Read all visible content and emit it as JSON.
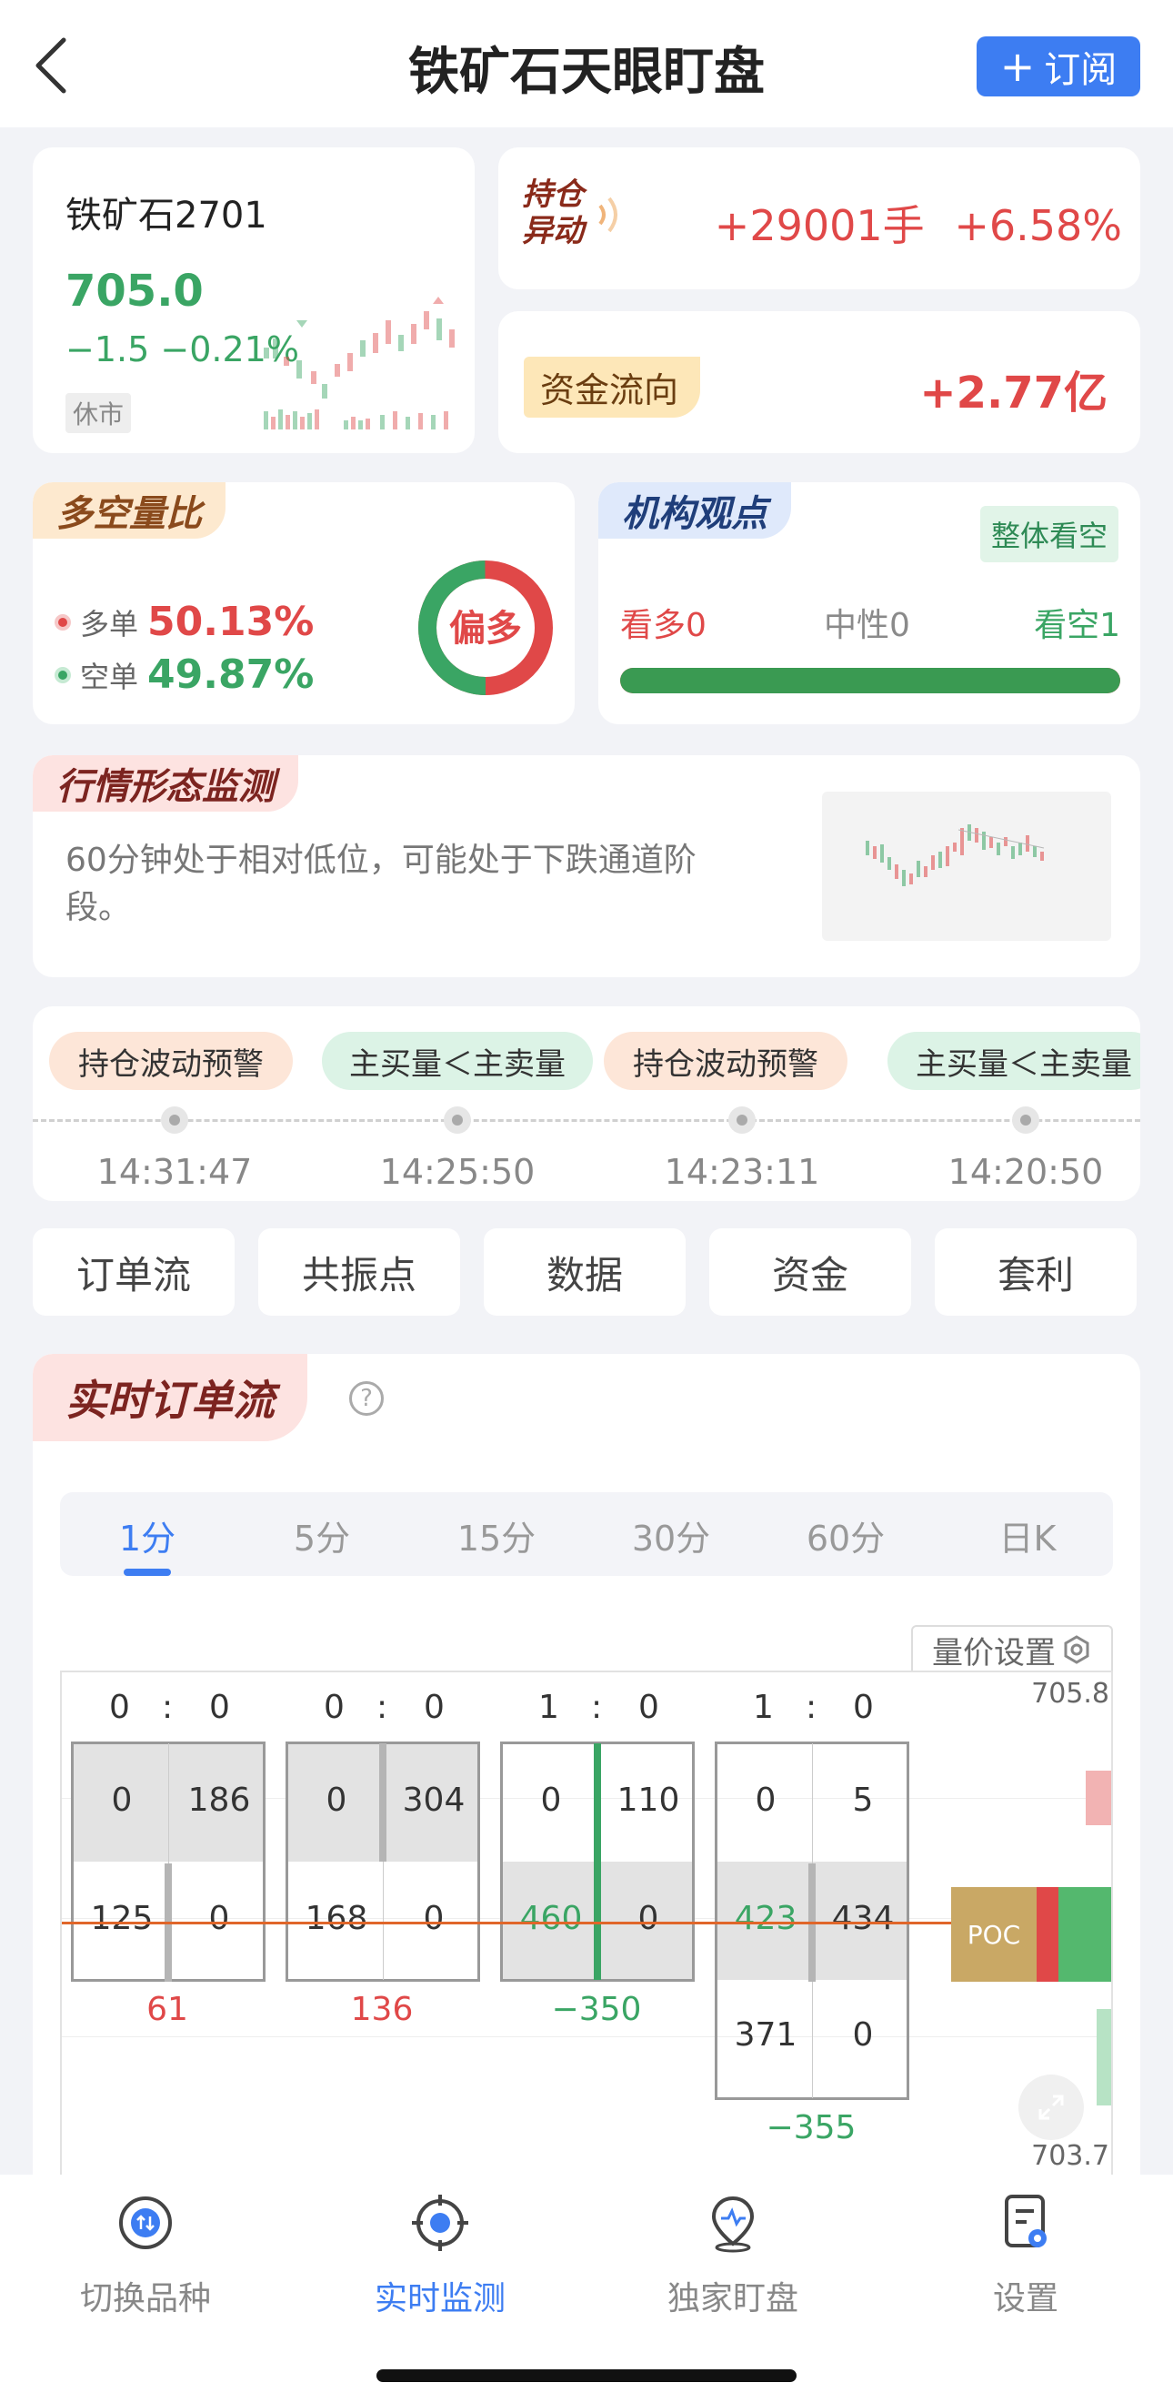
{
  "header": {
    "title": "铁矿石天眼盯盘",
    "subscribe_label": "订阅"
  },
  "quote": {
    "contract": "铁矿石2701",
    "price": "705.0",
    "change": "−1.5",
    "change_pct": "−0.21%",
    "status": "休市"
  },
  "position": {
    "tag": "持仓异动",
    "tag_line1": "持仓",
    "tag_line2": "异动",
    "lots": "+29001手",
    "pct": "+6.58%"
  },
  "fund_flow": {
    "tag": "资金流向",
    "value": "+2.77亿"
  },
  "long_short": {
    "tag": "多空量比",
    "long_label": "多单",
    "long_pct": "50.13%",
    "short_label": "空单",
    "short_pct": "49.87%",
    "bias": "偏多",
    "long_ratio": 0.5013
  },
  "institution": {
    "tag": "机构观点",
    "badge": "整体看空",
    "bull": "看多0",
    "neutral": "中性0",
    "bear": "看空1",
    "bear_ratio": 1.0
  },
  "pattern": {
    "tag": "行情形态监测",
    "text": "60分钟处于相对低位，可能处于下跌通道阶段。"
  },
  "timeline": [
    {
      "label": "持仓波动预警",
      "time": "14:31:47",
      "kind": "orange"
    },
    {
      "label": "主买量＜主卖量",
      "time": "14:25:50",
      "kind": "green"
    },
    {
      "label": "持仓波动预警",
      "time": "14:23:11",
      "kind": "orange"
    },
    {
      "label": "主买量＜主卖量",
      "time": "14:20:50",
      "kind": "green"
    }
  ],
  "sections": [
    "订单流",
    "共振点",
    "数据",
    "资金",
    "套利"
  ],
  "orderflow": {
    "title": "实时订单流",
    "help": "?",
    "periods": [
      "1分",
      "5分",
      "15分",
      "30分",
      "60分",
      "日K"
    ],
    "active_period": "1分",
    "settings_label": "量价设置",
    "price_high": "705.8",
    "price_low": "703.7",
    "poc_label": "POC",
    "bars": [
      {
        "score_left": "0",
        "score_right": "0",
        "rows": [
          [
            "0",
            "186"
          ],
          [
            "125",
            "0"
          ]
        ],
        "net": "61"
      },
      {
        "score_left": "0",
        "score_right": "0",
        "rows": [
          [
            "0",
            "304"
          ],
          [
            "168",
            "0"
          ]
        ],
        "net": "136"
      },
      {
        "score_left": "1",
        "score_right": "0",
        "rows": [
          [
            "0",
            "110"
          ],
          [
            "460",
            "0"
          ]
        ],
        "net": "−350"
      },
      {
        "score_left": "1",
        "score_right": "0",
        "rows": [
          [
            "0",
            "5"
          ],
          [
            "423",
            "434"
          ],
          [
            "371",
            "0"
          ]
        ],
        "net": "−355"
      }
    ]
  },
  "tabbar": [
    "切换品种",
    "实时监测",
    "独家盯盘",
    "设置"
  ],
  "colors": {
    "accent": "#3d7df2",
    "up": "#e04848",
    "down": "#3aa564"
  }
}
